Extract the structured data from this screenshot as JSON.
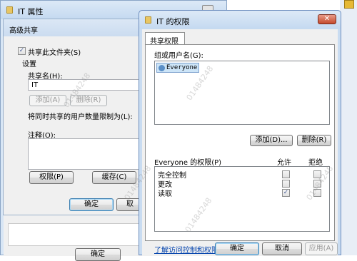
{
  "back_window": {
    "title": "IT 属性",
    "ok_label": "确定",
    "advanced_dialog": {
      "title": "高级共享",
      "share_checkbox_label": "共享此文件夹(S)",
      "settings_label": "设置",
      "share_name_label": "共享名(H):",
      "share_name_value": "IT",
      "add_label": "添加(A)",
      "remove_label": "删除(R)",
      "user_limit_label": "将同时共享的用户数量限制为(L):",
      "comment_label": "注释(O):",
      "permissions_button": "权限(P)",
      "cache_button": "缓存(C)",
      "ok_label": "确定",
      "cancel_label": "取"
    }
  },
  "perm_dialog": {
    "title": "IT 的权限",
    "tab_label": "共享权限",
    "group_label": "组或用户名(G):",
    "users": [
      "Everyone"
    ],
    "add_button": "添加(D)...",
    "remove_button": "删除(R)",
    "perm_header": "Everyone 的权限(P)",
    "allow_header": "允许",
    "deny_header": "拒绝",
    "permissions": [
      {
        "name": "完全控制",
        "allow": false,
        "deny": false
      },
      {
        "name": "更改",
        "allow": false,
        "deny": false
      },
      {
        "name": "读取",
        "allow": true,
        "deny": false
      }
    ],
    "link_text": "了解访问控制和权限",
    "ok_label": "确定",
    "cancel_label": "取消",
    "apply_label": "应用(A)"
  },
  "watermark": "01484248"
}
